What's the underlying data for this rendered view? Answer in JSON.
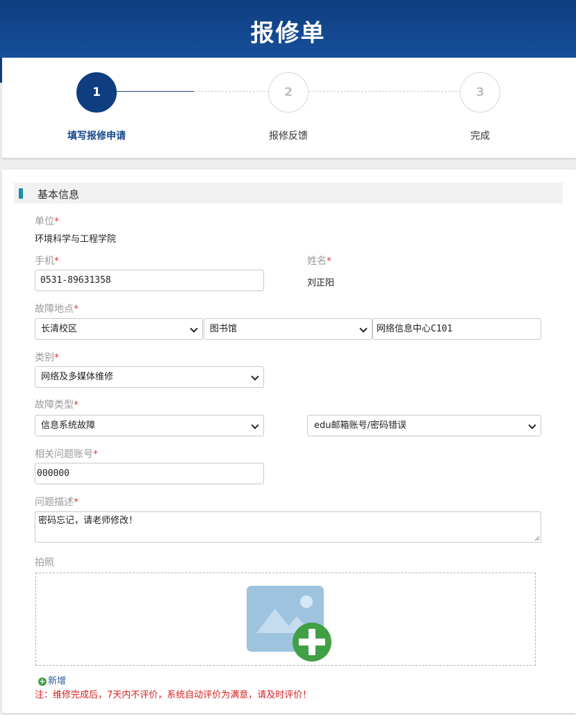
{
  "page": {
    "title": "报修单"
  },
  "steps": [
    {
      "number": "1",
      "label": "填写报修申请",
      "active": true
    },
    {
      "number": "2",
      "label": "报修反馈",
      "active": false
    },
    {
      "number": "3",
      "label": "完成",
      "active": false
    }
  ],
  "section": {
    "title": "基本信息"
  },
  "form": {
    "unit": {
      "label": "单位",
      "required": "*",
      "value": "环境科学与工程学院"
    },
    "phone": {
      "label": "手机",
      "required": "*",
      "value": "0531-89631358"
    },
    "name": {
      "label": "姓名",
      "required": "*",
      "value": "刘正阳"
    },
    "location": {
      "label": "故障地点",
      "required": "*",
      "campus": "长清校区",
      "building": "图书馆",
      "room": "网络信息中心C101"
    },
    "category": {
      "label": "类别",
      "required": "*",
      "value": "网络及多媒体维修"
    },
    "fault_type": {
      "label": "故障类型",
      "required": "*",
      "value": "信息系统故障",
      "sub_value": "edu邮箱账号/密码错误"
    },
    "account": {
      "label": "相关问题账号",
      "required": "*",
      "value": "000000"
    },
    "description": {
      "label": "问题描述",
      "required": "*",
      "value": "密码忘记，请老师修改！"
    },
    "photo": {
      "label": "拍照",
      "add_label": "新增"
    }
  },
  "note": "注：维修完成后，7天内不评价，系统自动评价为满意，请及时评价！",
  "colors": {
    "header": "#0e3d80",
    "accent": "#1b8fa8",
    "required": "#e04040",
    "note": "#d42020",
    "add_icon": "#41a046"
  },
  "icons": {
    "image_placeholder": "image-add-icon",
    "add": "plus-circle-icon",
    "dropdown": "chevron-down-icon"
  }
}
